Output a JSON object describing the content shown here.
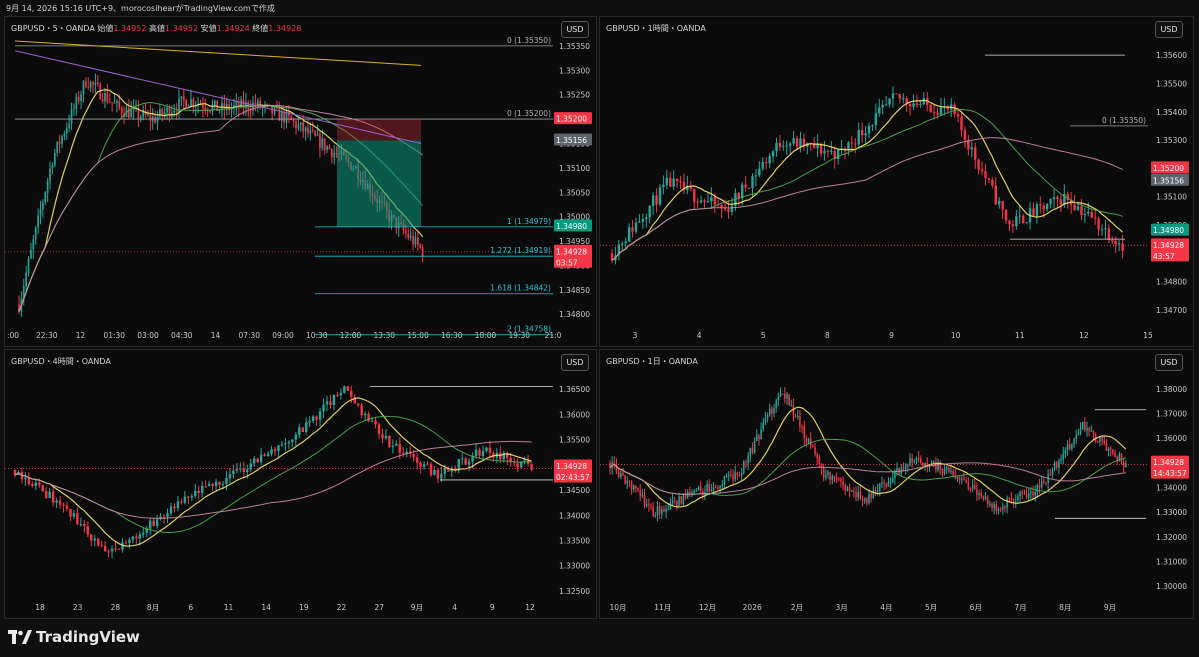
{
  "header_text": "9月 14, 2026 15:16 UTC+9、morocosihearがTradingView.comで作成",
  "brand": "TradingView",
  "colors": {
    "up": "#26a69a",
    "down": "#f23645",
    "ma_yellow": "#f5e46a",
    "ma_green": "#4caf50",
    "ma_pink": "#d18aa8",
    "ma_purple": "#9c5fd1",
    "ma_blue": "#3f6fe0",
    "ma_gold": "#e0b020",
    "cyan": "#26c6da",
    "white": "#e0e0e0"
  },
  "panels": [
    {
      "id": "p5m",
      "title_prefix": "GBPUSD・5・OANDA",
      "ohlc": [
        {
          "k": "始値",
          "v": "1.34952"
        },
        {
          "k": "高値",
          "v": "1.34952"
        },
        {
          "k": "安値",
          "v": "1.34924"
        },
        {
          "k": "終値",
          "v": "1.34928"
        }
      ],
      "currency": "USD",
      "price_labels": [
        "1.35350",
        "1.35300",
        "1.35250",
        "1.35200",
        "1.35150",
        "1.35100",
        "1.35050",
        "1.35000",
        "1.34950",
        "1.34900",
        "1.34850",
        "1.34800"
      ],
      "time_labels": [
        ":00",
        "22:30",
        "12",
        "01:30",
        "03:00",
        "04:30",
        "14",
        "07:30",
        "09:00",
        "10:30",
        "12:00",
        "13:30",
        "15:00",
        "16:30",
        "18:00",
        "19:30",
        "21:0"
      ],
      "fib_labels": [
        "0 (1.35350)",
        "0 (1.35200)",
        "1 (1.34979)",
        "1.272 (1.34919)",
        "1.618 (1.34842)",
        "2 (1.34758)"
      ],
      "tags": [
        {
          "t": "1.35200",
          "c": "#f23645"
        },
        {
          "t": "1.35156",
          "c": "#5d6470"
        },
        {
          "t": "1.34980",
          "c": "#089981"
        },
        {
          "t": "1.34928",
          "c": "#f23645"
        },
        {
          "t": "03:57",
          "c": "#f23645"
        }
      ]
    },
    {
      "id": "p1h",
      "title": "GBPUSD・1時間・OANDA",
      "currency": "USD",
      "price_labels": [
        "1.35600",
        "1.35500",
        "1.35400",
        "1.35300",
        "1.35200",
        "1.35100",
        "1.35000",
        "1.34900",
        "1.34800",
        "1.34700"
      ],
      "time_labels": [
        "3",
        "4",
        "5",
        "8",
        "9",
        "10",
        "11",
        "12",
        "15"
      ],
      "fib_labels": [
        "0 (1.35350)"
      ],
      "tags": [
        {
          "t": "1.35200",
          "c": "#f23645"
        },
        {
          "t": "1.35156",
          "c": "#5d6470"
        },
        {
          "t": "1.34980",
          "c": "#089981"
        },
        {
          "t": "1.34928",
          "c": "#f23645"
        },
        {
          "t": "43:57",
          "c": "#f23645"
        }
      ]
    },
    {
      "id": "p4h",
      "title": "GBPUSD・4時間・OANDA",
      "currency": "USD",
      "price_labels": [
        "1.36500",
        "1.36000",
        "1.35500",
        "1.35000",
        "1.34500",
        "1.34000",
        "1.33500",
        "1.33000",
        "1.32500"
      ],
      "time_labels": [
        "18",
        "23",
        "28",
        "8月",
        "6",
        "11",
        "14",
        "19",
        "22",
        "27",
        "9月",
        "4",
        "9",
        "12"
      ],
      "tags": [
        {
          "t": "1.34928",
          "c": "#f23645"
        },
        {
          "t": "02:43:57",
          "c": "#f23645"
        }
      ]
    },
    {
      "id": "p1d",
      "title": "GBPUSD・1日・OANDA",
      "currency": "USD",
      "price_labels": [
        "1.38000",
        "1.37000",
        "1.36000",
        "1.35000",
        "1.34000",
        "1.33000",
        "1.32000",
        "1.31000",
        "1.30000"
      ],
      "time_labels": [
        "10月",
        "11月",
        "12月",
        "2026",
        "2月",
        "3月",
        "4月",
        "5月",
        "6月",
        "7月",
        "8月",
        "9月"
      ],
      "tags": [
        {
          "t": "1.34928",
          "c": "#f23645"
        },
        {
          "t": "14:43:57",
          "c": "#f23645"
        }
      ]
    }
  ],
  "chart_data": [
    {
      "type": "candlestick",
      "title": "GBPUSD・5・OANDA",
      "x": [
        ":00",
        "22:30",
        "12",
        "01:30",
        "03:00",
        "04:30",
        "14",
        "07:30",
        "09:00",
        "10:30",
        "12:00",
        "13:30",
        "15:00"
      ],
      "close_path": [
        1.3482,
        1.3512,
        1.3528,
        1.3522,
        1.352,
        1.3524,
        1.3522,
        1.3523,
        1.352,
        1.3515,
        1.351,
        1.35,
        1.3493
      ],
      "ylim": [
        1.3478,
        1.3536
      ],
      "last": 1.34928
    },
    {
      "type": "candlestick",
      "title": "GBPUSD・1時間・OANDA",
      "x": [
        "3",
        "4",
        "5",
        "8",
        "9",
        "10",
        "11",
        "12"
      ],
      "close_path": [
        1.349,
        1.3515,
        1.3505,
        1.353,
        1.3525,
        1.3545,
        1.354,
        1.35,
        1.351,
        1.3493
      ],
      "ylim": [
        1.3465,
        1.3565
      ],
      "last": 1.34928
    },
    {
      "type": "candlestick",
      "title": "GBPUSD・4時間・OANDA",
      "x": [
        "18",
        "23",
        "28",
        "8月",
        "6",
        "11",
        "14",
        "19",
        "22",
        "27",
        "9月",
        "4",
        "9",
        "12"
      ],
      "close_path": [
        1.349,
        1.342,
        1.332,
        1.339,
        1.345,
        1.35,
        1.356,
        1.365,
        1.354,
        1.348,
        1.353,
        1.3493
      ],
      "ylim": [
        1.324,
        1.368
      ],
      "last": 1.34928
    },
    {
      "type": "candlestick",
      "title": "GBPUSD・1日・OANDA",
      "x": [
        "10月",
        "11月",
        "12月",
        "2026",
        "2月",
        "3月",
        "4月",
        "5月",
        "6月",
        "7月",
        "8月",
        "9月"
      ],
      "close_path": [
        1.35,
        1.33,
        1.338,
        1.345,
        1.38,
        1.345,
        1.335,
        1.352,
        1.346,
        1.332,
        1.34,
        1.365,
        1.3493
      ],
      "ylim": [
        1.296,
        1.386
      ],
      "last": 1.34928
    }
  ]
}
